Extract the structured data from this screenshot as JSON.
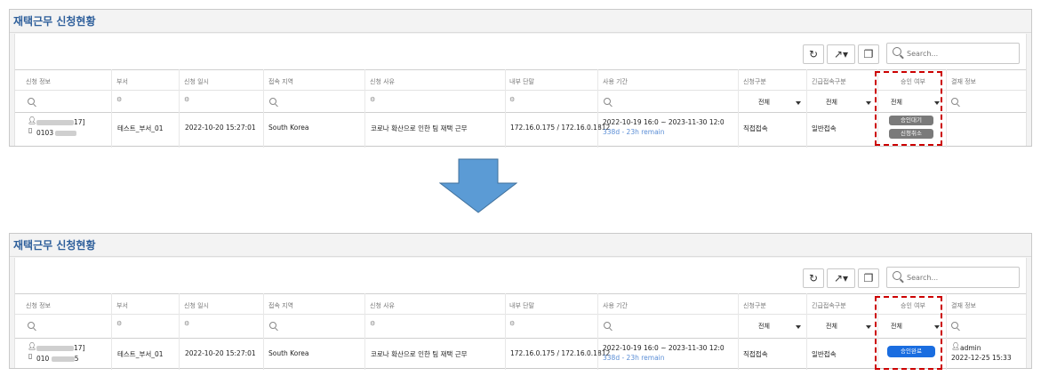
{
  "panel_title": "재택근무 신청현황",
  "search_placeholder": "Search...",
  "toolbar": {
    "refresh_icon": "refresh-icon",
    "export_icon": "export-icon",
    "columns_icon": "columns-icon"
  },
  "columns": [
    "신청 정보",
    "부서",
    "신청 일시",
    "접속 지역",
    "신청 사유",
    "내부 단말",
    "사용 기간",
    "신청구분",
    "긴급접속구분",
    "승인 여부",
    "결재 정보"
  ],
  "filter_all": "전체",
  "colors": {
    "title": "#2e5f9b",
    "approve_blue": "#1a6de0",
    "pending_gray": "#7a7a7a",
    "highlight_red": "#cc0000",
    "arrow_blue": "#5b9bd5"
  },
  "before": {
    "row": {
      "applicant_suffix": "17]",
      "phone_prefix": "0103",
      "dept": "테스트_부서_01",
      "applied_at": "2022-10-20 15:27:01",
      "region": "South Korea",
      "reason": "코로나 확산으로 인한 팀 재택 근무",
      "terminal": "172.16.0.175 / 172.16.0.1812",
      "period": "2022-10-19 16:0 ~ 2023-11-30 12:0",
      "remain": "338d - 23h remain",
      "apply_type": "직접접속",
      "urgent_type": "일반접속",
      "status_btn1": "승인대기",
      "status_btn2": "신청취소"
    }
  },
  "after": {
    "row": {
      "applicant_suffix": "17]",
      "phone_prefix": "010",
      "phone_suffix": "5",
      "dept": "테스트_부서_01",
      "applied_at": "2022-10-20 15:27:01",
      "region": "South Korea",
      "reason": "코로나 확산으로 인한 팀 재택 근무",
      "terminal": "172.16.0.175 / 172.16.0.1812",
      "period": "2022-10-19 16:0 ~ 2023-11-30 12:0",
      "remain": "338d - 23h remain",
      "apply_type": "직접접속",
      "urgent_type": "일반접속",
      "status_btn": "승인완료",
      "approver": "admin",
      "approved_at": "2022-12-25 15:33"
    }
  }
}
